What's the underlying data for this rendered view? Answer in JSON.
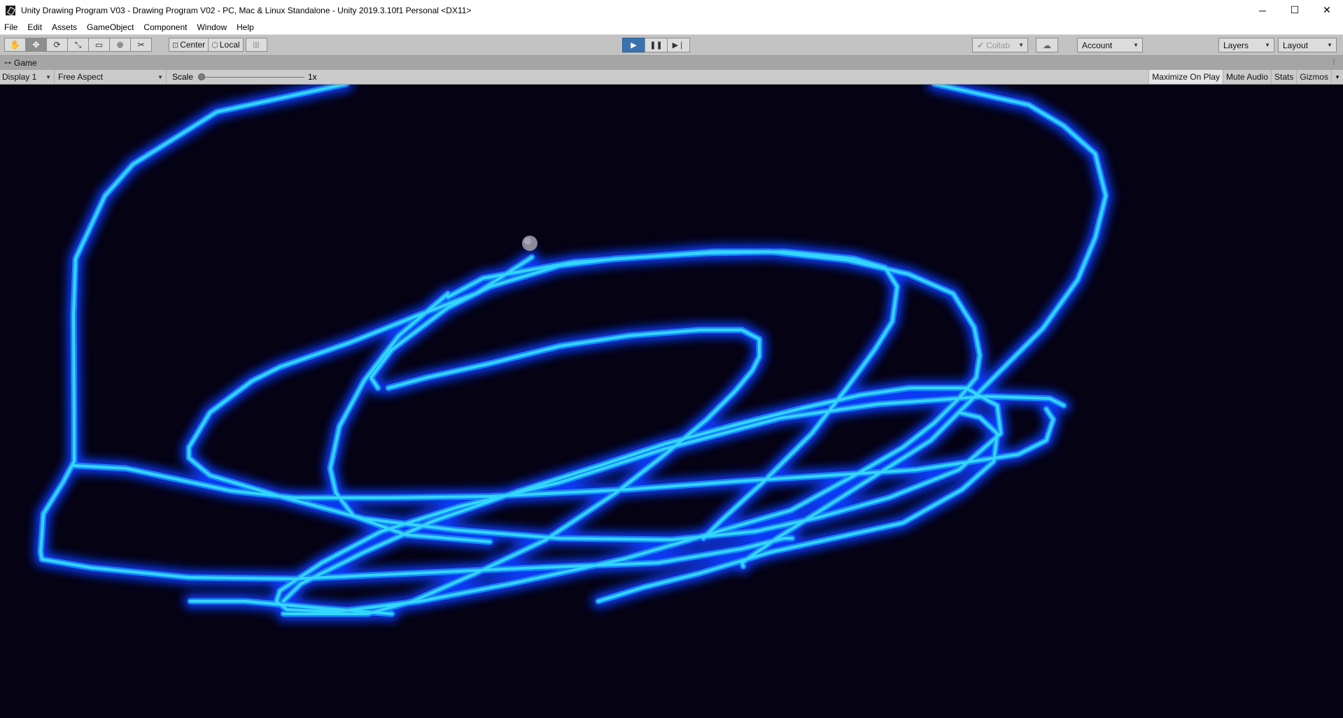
{
  "window": {
    "title": "Unity Drawing Program V03 - Drawing Program V02 - PC, Mac & Linux Standalone - Unity 2019.3.10f1 Personal <DX11>",
    "controls": {
      "minimize": "─",
      "maximize": "☐",
      "close": "✕"
    }
  },
  "menu": {
    "items": [
      "File",
      "Edit",
      "Assets",
      "GameObject",
      "Component",
      "Window",
      "Help"
    ]
  },
  "toolbar": {
    "tools": [
      {
        "icon": "hand-icon",
        "glyph": "✋"
      },
      {
        "icon": "move-icon",
        "glyph": "✥"
      },
      {
        "icon": "rotate-icon",
        "glyph": "⟳"
      },
      {
        "icon": "scale-icon",
        "glyph": "⤡"
      },
      {
        "icon": "rect-icon",
        "glyph": "▭"
      },
      {
        "icon": "transform-icon",
        "glyph": "⊛"
      },
      {
        "icon": "custom-tool-icon",
        "glyph": "✂"
      }
    ],
    "pivot_label": "Center",
    "space_label": "Local",
    "play_glyph": "▶",
    "pause_glyph": "❚❚",
    "step_glyph": "▶❘",
    "collab_label": "Collab",
    "account_label": "Account",
    "layers_label": "Layers",
    "layout_label": "Layout"
  },
  "game_tab": {
    "label": "Game",
    "display": "Display 1",
    "aspect": "Free Aspect",
    "scale_label": "Scale",
    "scale_value": "1x",
    "maximize_on_play": "Maximize On Play",
    "mute_audio": "Mute Audio",
    "stats": "Stats",
    "gizmos": "Gizmos"
  },
  "colors": {
    "viewport_bg": "#050214",
    "stroke_core": "#33d6ff",
    "stroke_glow": "#0a3cff",
    "play_active": "#3a72b0"
  }
}
